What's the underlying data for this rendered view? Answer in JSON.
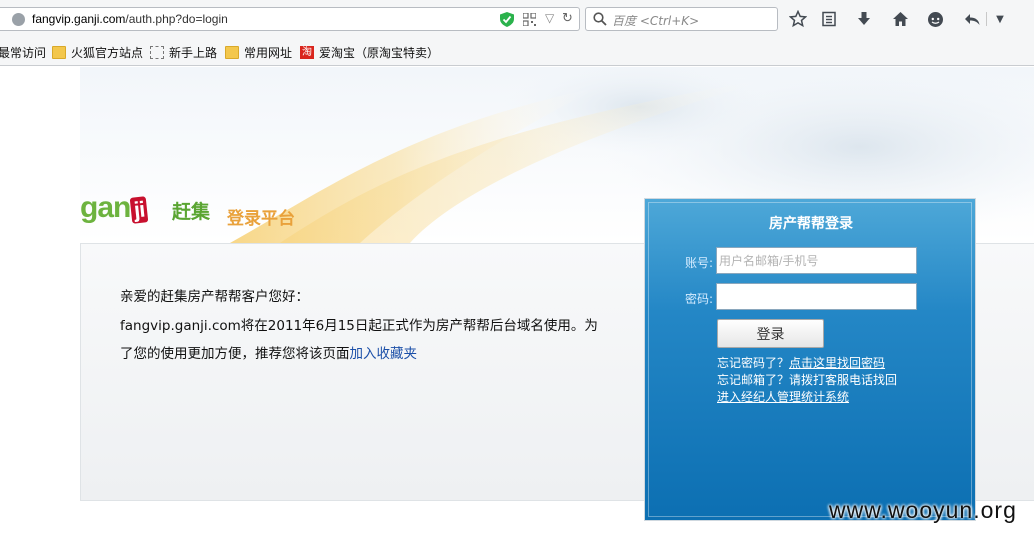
{
  "browser": {
    "url_host": "fangvip.ganji.com",
    "url_path": "/auth.php?do=login",
    "search_placeholder": "百度 <Ctrl+K>"
  },
  "bookmarks": [
    {
      "label": "最常访问",
      "icon": "none"
    },
    {
      "label": "火狐官方站点",
      "icon": "folder"
    },
    {
      "label": "新手上路",
      "icon": "dashed"
    },
    {
      "label": "常用网址",
      "icon": "folder"
    },
    {
      "label": "爱淘宝（原淘宝特卖）",
      "icon": "taobao",
      "icon_text": "淘"
    }
  ],
  "page": {
    "logo_latin": "gan",
    "logo_ji": "ji",
    "logo_cn": "赶集",
    "logo_sub": "登录平台",
    "greeting": "亲爱的赶集房产帮帮客户您好：",
    "notice_line1": "fangvip.ganji.com将在2011年6月15日起正式作为房产帮帮后台域名使用。为",
    "notice_line2": "了您的使用更加方便，推荐您将该页面",
    "favorite_link": "加入收藏夹"
  },
  "login": {
    "title": "房产帮帮登录",
    "account_label": "账号:",
    "account_placeholder": "用户名邮箱/手机号",
    "password_label": "密码:",
    "submit_label": "登录",
    "forgot_password_text": "忘记密码了？",
    "forgot_password_link": "点击这里找回密码",
    "forgot_email_text": "忘记邮箱了？请拨打客服电话找回",
    "agent_link": "进入经纪人管理统计系统"
  },
  "watermark": "www.wooyun.org",
  "colors": {
    "panel_blue": "#1a7fc0",
    "link_blue": "#1b4fa8",
    "ganji_green": "#6db33f",
    "ganji_red": "#c8102e",
    "accent_orange": "#e9a13b"
  }
}
